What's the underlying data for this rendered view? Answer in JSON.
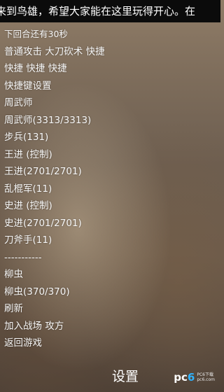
{
  "marquee": {
    "text": "来到鸟雄，希望大家能在这里玩得开心。在"
  },
  "menu": {
    "items": [
      "下回合还有30秒",
      "普通攻击 大刀砍术 快捷",
      "快捷 快捷 快捷",
      "快捷键设置",
      "周武师",
      "周武师(3313/3313)",
      "步兵(131)",
      "王进 (控制)",
      "王进(2701/2701)",
      "乱棍军(11)",
      "史进 (控制)",
      "史进(2701/2701)",
      "刀斧手(11)",
      "-----------",
      "柳虫",
      "柳虫(370/370)",
      "刷新",
      "加入战场 攻方",
      "返回游戏"
    ]
  },
  "bottom": {
    "settings_label": "设置"
  },
  "watermark": {
    "logo_pc": "pc",
    "logo_six": "6",
    "line1": "PC6下载",
    "line2": "pc6.com"
  }
}
